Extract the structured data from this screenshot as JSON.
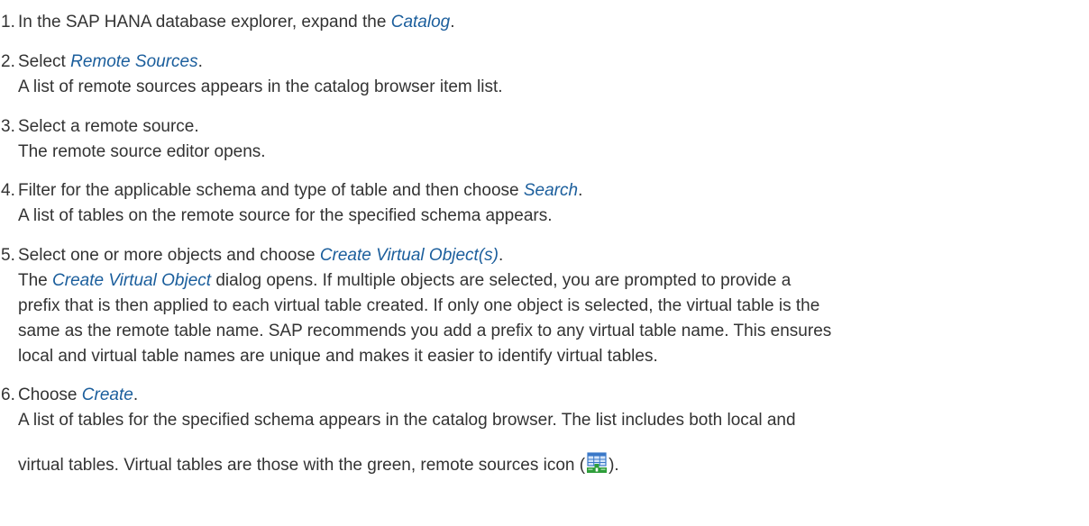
{
  "steps": [
    {
      "num": "1.",
      "pre": "In the SAP HANA database explorer, expand the ",
      "link": "Catalog",
      "post": "."
    },
    {
      "num": "2.",
      "pre": "Select ",
      "link": "Remote Sources",
      "post": ".",
      "result": "A list of remote sources appears in the catalog browser item list."
    },
    {
      "num": "3.",
      "text": "Select a remote source.",
      "result": "The remote source editor opens."
    },
    {
      "num": "4.",
      "pre": "Filter for the applicable schema and type of table and then choose ",
      "link": "Search",
      "post": ".",
      "result": "A list of tables on the remote source for the specified schema appears."
    },
    {
      "num": "5.",
      "pre": "Select one or more objects and choose ",
      "link": "Create Virtual Object(s)",
      "post": ".",
      "result_pre": "The ",
      "result_link": "Create Virtual Object",
      "result_l1": " dialog opens. If multiple objects are selected, you are prompted to provide a",
      "result_l2": "prefix that is then applied to each virtual table created. If only one object is selected, the virtual table is the",
      "result_l3": "same as the remote table name. SAP recommends you add a prefix to any virtual table name. This ensures",
      "result_l4": "local and virtual table names are unique and makes it easier to identify virtual tables."
    },
    {
      "num": "6.",
      "pre": "Choose ",
      "link": "Create",
      "post": ".",
      "result_l1": "A list of tables for the specified schema appears in the catalog browser. The list includes both local and",
      "result_l2_pre": "virtual tables. Virtual tables are those with the green, remote sources icon (",
      "result_l2_post": ")."
    }
  ],
  "icon": {
    "name": "remote-sources-icon",
    "grid_color": "#3a78c8",
    "grid_fill": "#d6e6fa",
    "accent_color": "#2e9e3a"
  },
  "colors": {
    "text": "#333333",
    "link": "#1b5e9c"
  }
}
